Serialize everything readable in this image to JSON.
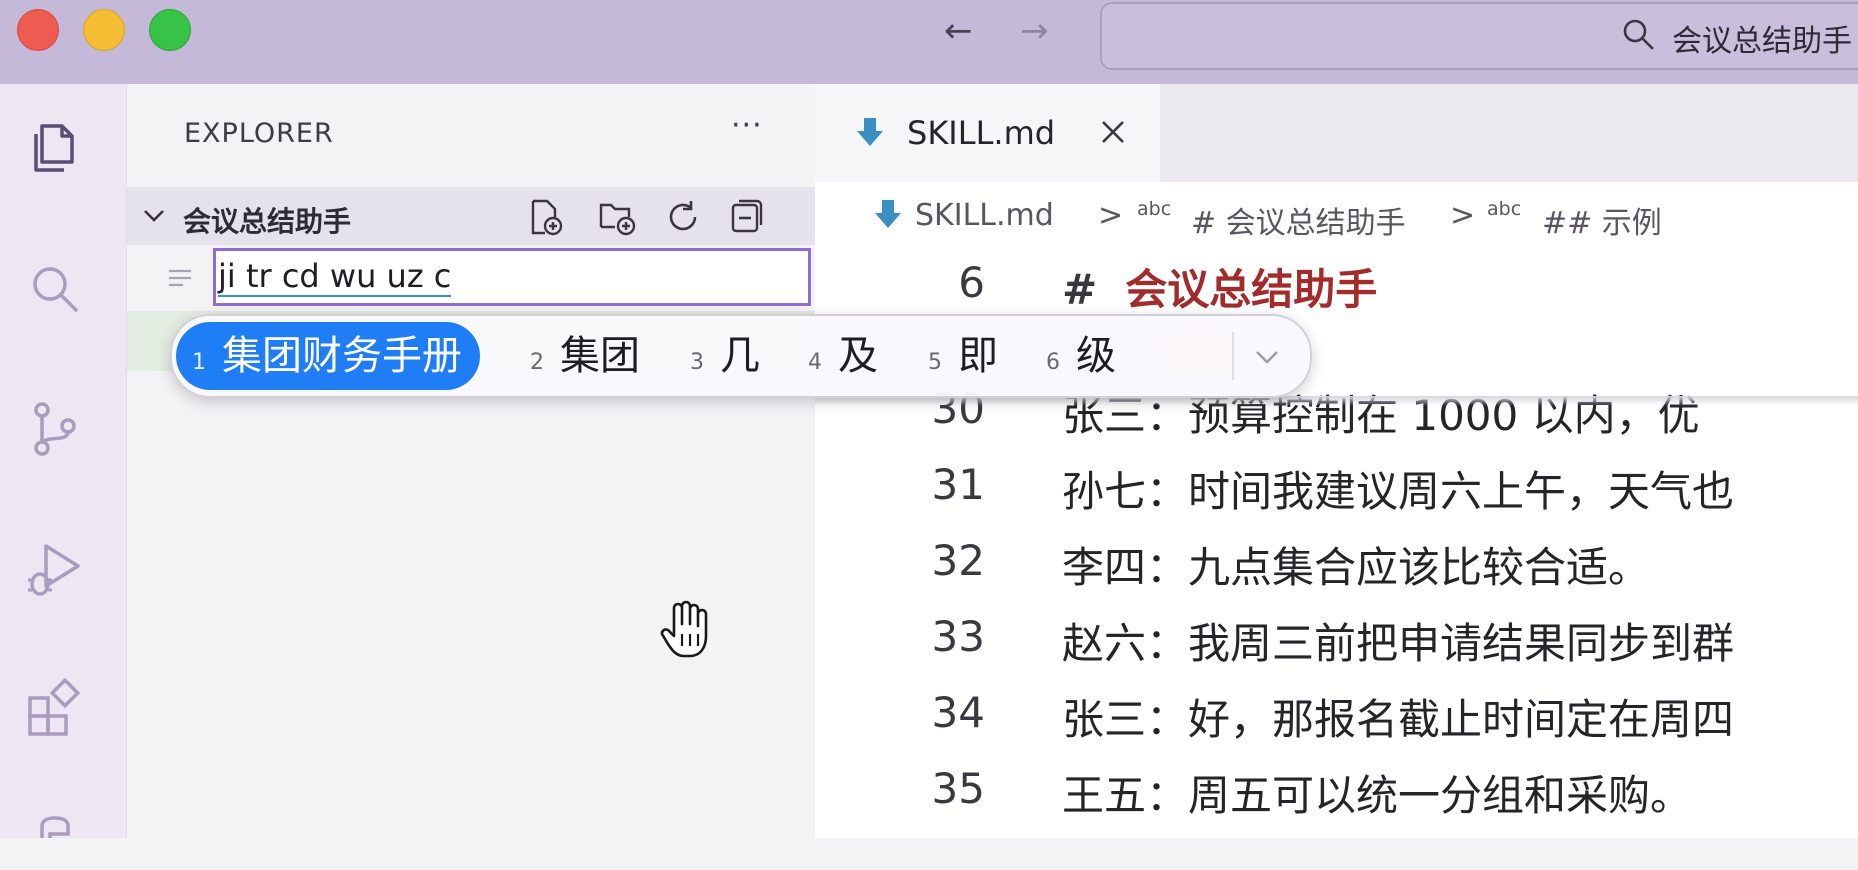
{
  "titlebar": {
    "nav_back": "←",
    "nav_forward": "→",
    "search_text": "会议总结助手"
  },
  "sidebar": {
    "title": "EXPLORER",
    "more": "···",
    "folder_name": "会议总结助手",
    "rename_value": "ji tr cd wu uz c"
  },
  "ime": {
    "candidates": [
      {
        "num": "1",
        "text": "集团财务手册"
      },
      {
        "num": "2",
        "text": "集团"
      },
      {
        "num": "3",
        "text": "几"
      },
      {
        "num": "4",
        "text": "及"
      },
      {
        "num": "5",
        "text": "即"
      },
      {
        "num": "6",
        "text": "级"
      }
    ]
  },
  "editor": {
    "tab_label": "SKILL.md",
    "breadcrumb": {
      "file": "SKILL.md",
      "sep": ">",
      "abc": "abc",
      "h1": "# 会议总结助手",
      "h2": "## 示例"
    },
    "heading_line": {
      "num": "6",
      "hash": "#",
      "text": "会议总结助手"
    },
    "lines": [
      {
        "num": "30",
        "text": "张三：预算控制在 1000 以内，优"
      },
      {
        "num": "31",
        "text": "孙七：时间我建议周六上午，天气也"
      },
      {
        "num": "32",
        "text": "李四：九点集合应该比较合适。"
      },
      {
        "num": "33",
        "text": "赵六：我周三前把申请结果同步到群"
      },
      {
        "num": "34",
        "text": "张三：好，那报名截止时间定在周四"
      },
      {
        "num": "35",
        "text": "王五：周五可以统一分组和采购。"
      }
    ]
  },
  "colors": {
    "titlebar": "#c5b9d9",
    "ime_selected": "#1f7ef5",
    "heading": "#a32b2b",
    "md_icon": "#3a8fc4"
  }
}
